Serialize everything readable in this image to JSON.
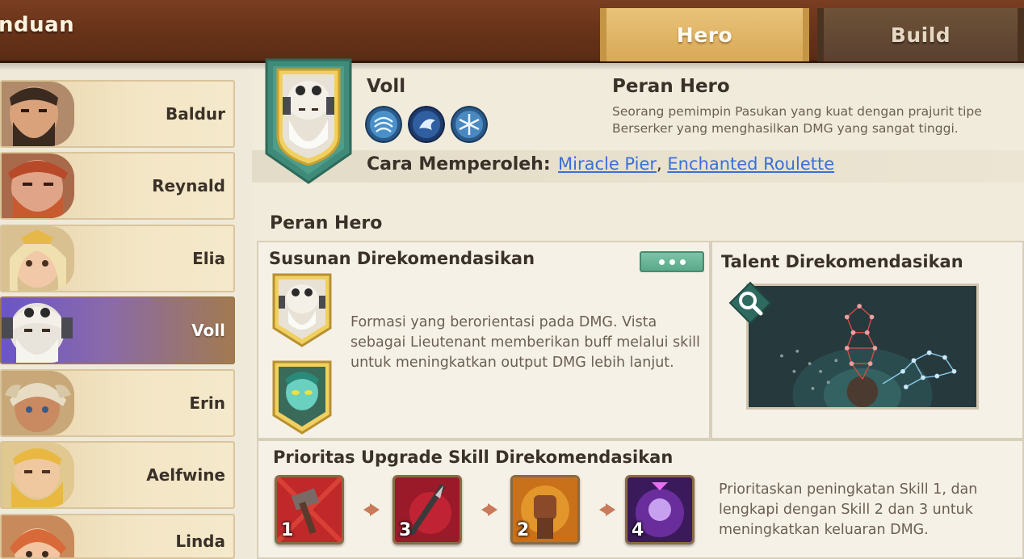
{
  "header": {
    "title": "nduan",
    "tabs": [
      {
        "label": "Hero",
        "active": true
      },
      {
        "label": "Build",
        "active": false
      }
    ]
  },
  "hero_list": [
    {
      "name": "Baldur"
    },
    {
      "name": "Reynald"
    },
    {
      "name": "Elia"
    },
    {
      "name": "Voll",
      "selected": true
    },
    {
      "name": "Erin"
    },
    {
      "name": "Aelfwine"
    },
    {
      "name": "Linda"
    }
  ],
  "hero": {
    "name": "Voll",
    "skill_icons": [
      "wind-skill-icon",
      "storm-skill-icon",
      "frost-skill-icon"
    ],
    "role_title": "Peran Hero",
    "role_desc": "Seorang pemimpin Pasukan yang kuat dengan prajurit tipe Berserker yang menghasilkan DMG yang sangat tinggi.",
    "obtain_label": "Cara Memperoleh:",
    "obtain_links": [
      "Miracle Pier",
      "Enchanted Roulette"
    ],
    "obtain_sep": ","
  },
  "role_section": {
    "title": "Peran Hero"
  },
  "formation": {
    "title": "Susunan Direkomendasikan",
    "text": "Formasi yang berorientasi pada DMG. Vista sebagai Lieutenant memberikan buff melalui skill untuk meningkatkan output DMG lebih lanjut."
  },
  "talent": {
    "title": "Talent Direkomendasikan"
  },
  "priority": {
    "title": "Prioritas Upgrade Skill Direkomendasikan",
    "skills": [
      "1",
      "3",
      "2",
      "4"
    ],
    "text": "Prioritaskan peningkatan Skill 1, dan lengkapi dengan Skill 2 dan 3 untuk meningkatkan keluaran DMG."
  },
  "colors": {
    "link": "#3b6fd8",
    "accent_green": "#5aa88a",
    "selected_purple": "#6a55c8"
  }
}
